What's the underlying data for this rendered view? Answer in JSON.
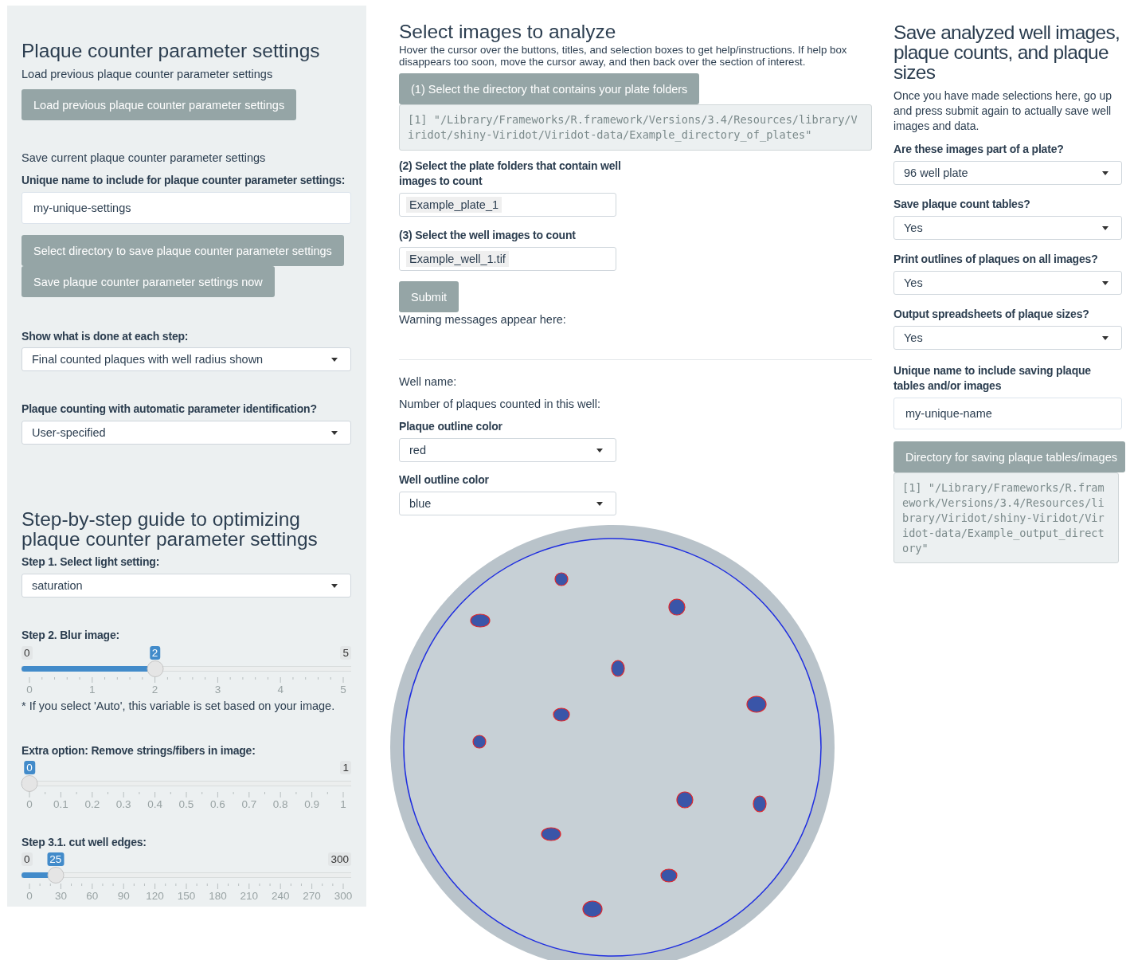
{
  "settings_panel": {
    "title": "Plaque counter parameter settings",
    "load_label": "Load previous plaque counter parameter settings",
    "load_button": "Load previous plaque counter parameter settings",
    "save_label": "Save current plaque counter parameter settings",
    "name_label": "Unique name to include for plaque counter parameter settings:",
    "name_value": "my-unique-settings",
    "dir_button": "Select directory to save plaque counter parameter settings",
    "save_button": "Save plaque counter parameter settings now",
    "steps_label": "Show what is done at each step:",
    "steps_value": "Final counted plaques with well radius shown",
    "auto_label": "Plaque counting with automatic parameter identification?",
    "auto_value": "User-specified"
  },
  "guide": {
    "title": "Step-by-step guide to optimizing plaque counter parameter settings",
    "light_label": "Step 1. Select light setting:",
    "light_value": "saturation",
    "blur": {
      "label": "Step 2. Blur image:",
      "min_label": "0",
      "max_label": "5",
      "value_label": "2",
      "level": 0.4,
      "ticks": [
        "0",
        "1",
        "2",
        "3",
        "4",
        "5"
      ]
    },
    "blur_note": "* If you select 'Auto', this variable is set based on your image.",
    "fibers": {
      "label": "Extra option: Remove strings/fibers in image:",
      "max_label": "1",
      "value_label": "0",
      "level": 0,
      "ticks": [
        "0",
        "0.1",
        "0.2",
        "0.3",
        "0.4",
        "0.5",
        "0.6",
        "0.7",
        "0.8",
        "0.9",
        "1"
      ]
    },
    "cut_edges": {
      "label": "Step 3.1. cut well edges:",
      "min_label": "0",
      "max_label": "300",
      "value_label": "25",
      "level": 0.0833,
      "ticks": [
        "0",
        "30",
        "60",
        "90",
        "120",
        "150",
        "180",
        "210",
        "240",
        "270",
        "300"
      ]
    }
  },
  "analyze": {
    "title": "Select images to analyze",
    "help": "Hover the cursor over the buttons, titles, and selection boxes to get help/instructions. If help box disappears too soon, move the cursor away, and then back over the section of interest.",
    "dir_button": "(1) Select the directory that contains your plate folders",
    "dir_path": "[1] \"/Library/Frameworks/R.framework/Versions/3.4/Resources/library/Viridot/shiny-Viridot/Viridot-data/Example_directory_of_plates\"",
    "plates_label": "(2) Select the plate folders that contain well images to count",
    "plates_value": "Example_plate_1",
    "wells_label": "(3) Select the well images to count",
    "wells_value": "Example_well_1.tif",
    "submit_button": "Submit",
    "warning_label": "Warning messages appear here:",
    "well_name_label": "Well name:",
    "count_label": "Number of plaques counted in this well:",
    "plaque_color_label": "Plaque outline color",
    "plaque_color_value": "red",
    "well_color_label": "Well outline color",
    "well_color_value": "blue"
  },
  "save": {
    "title": "Save analyzed well images, plaque counts, and plaque sizes",
    "intro": "Once you have made selections here, go up and press submit again to actually save well images and data.",
    "selects": [
      {
        "label": "Are these images part of a plate?",
        "value": "96 well plate"
      },
      {
        "label": "Save plaque count tables?",
        "value": "Yes"
      },
      {
        "label": "Print outlines of plaques on all images?",
        "value": "Yes"
      },
      {
        "label": "Output spreadsheets of plaque sizes?",
        "value": "Yes"
      }
    ],
    "name_label": "Unique name to include saving plaque tables and/or images",
    "name_value": "my-unique-name",
    "dir_button": "Directory for saving plaque tables/images",
    "dir_path": "[1] \"/Library/Frameworks/R.framework/Versions/3.4/Resources/library/Viridot/shiny-Viridot/Viridot-data/Example_output_directory\""
  }
}
